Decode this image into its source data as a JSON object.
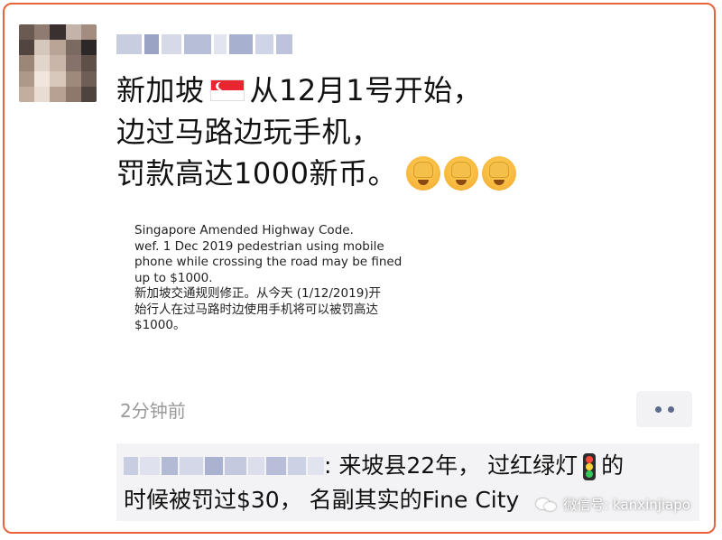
{
  "post": {
    "line1_before_flag": "新加坡",
    "line1_after_flag": "从12月1号开始，",
    "line2": "边过马路边玩手机，",
    "line3": "罚款高达1000新币。",
    "flag_icon": "singapore-flag-icon",
    "emoji_icon": "facepalm-crying-emoji",
    "emoji_count": 3
  },
  "image_card": {
    "text": "Singapore Amended Highway Code.\nwef. 1 Dec 2019 pedestrian using mobile\nphone while crossing the road may be fined\nup to $1000.\n新加坡交通规则修正。从今天 (1/12/2019)开\n始行人在过马路时边使用手机将可以被罚高达\n$1000。"
  },
  "meta": {
    "time": "2分钟前",
    "more_icon": "more-dots-icon"
  },
  "comment": {
    "part1": ": 来坡县22年， 过红绿灯",
    "part2": "的",
    "line2": "时候被罚过$30， 名副其实的Fine City",
    "traffic_icon": "traffic-light-icon"
  },
  "watermark": {
    "text": "微信号: kanxinjiapo",
    "icon": "wechat-icon"
  },
  "colors": {
    "frame": "#e8623a",
    "comment_bg": "#f3f3f5",
    "time": "#9a9a9a",
    "more_dots": "#5c6b8a"
  }
}
